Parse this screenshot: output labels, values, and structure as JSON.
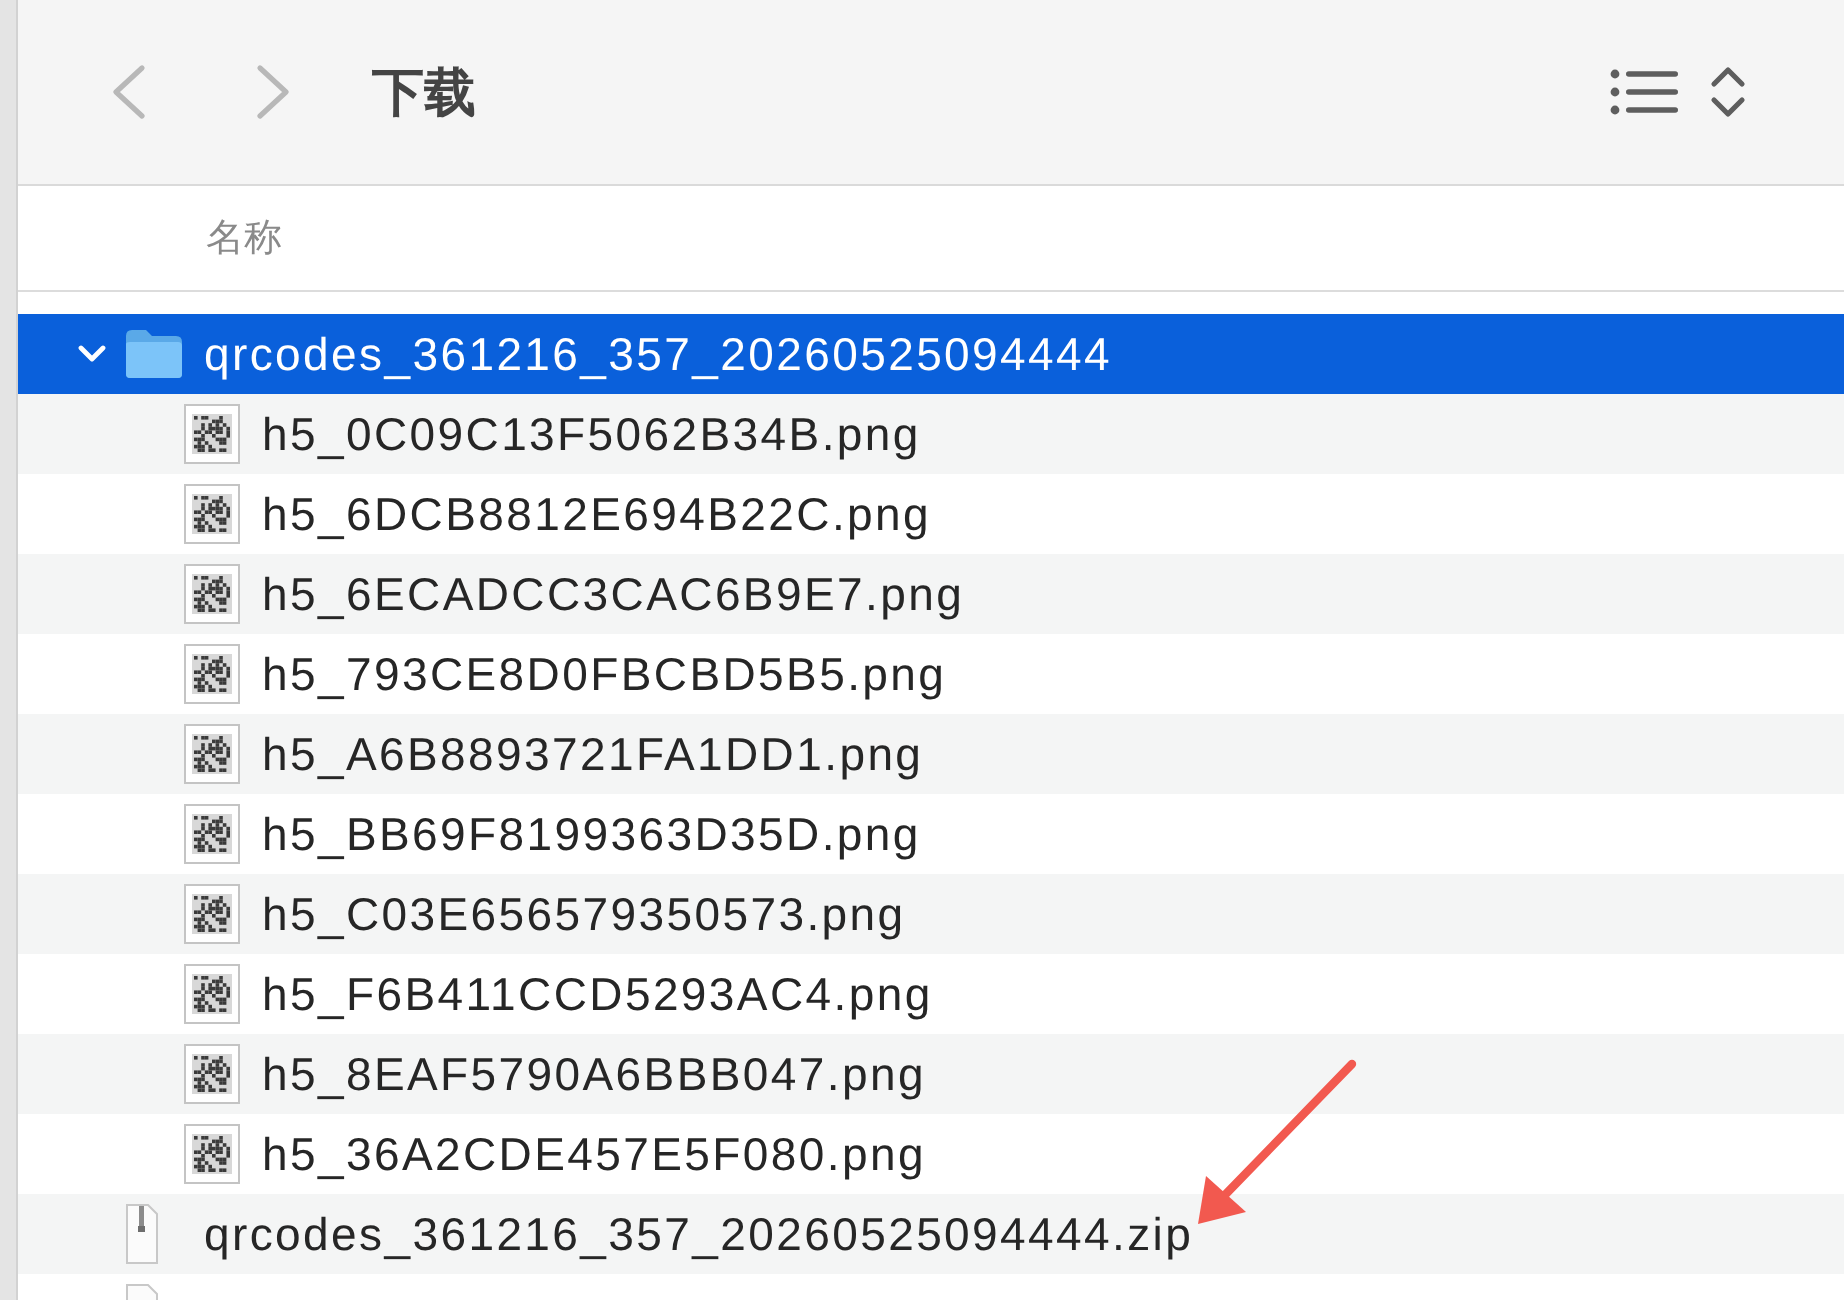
{
  "window": {
    "title": "下载"
  },
  "toolbar": {
    "back_button": {
      "disabled": true
    },
    "forward_button": {
      "disabled": true
    }
  },
  "columns": [
    "名称"
  ],
  "files": [
    {
      "kind": "folder",
      "name": "qrcodes_361216_357_20260525094444",
      "selected": true,
      "expanded": true,
      "children": [
        {
          "kind": "image",
          "name": "h5_0C09C13F5062B34B.png",
          "selected": false
        },
        {
          "kind": "image",
          "name": "h5_6DCB8812E694B22C.png",
          "selected": false
        },
        {
          "kind": "image",
          "name": "h5_6ECADCC3CAC6B9E7.png",
          "selected": false
        },
        {
          "kind": "image",
          "name": "h5_793CE8D0FBCBD5B5.png",
          "selected": false
        },
        {
          "kind": "image",
          "name": "h5_A6B8893721FA1DD1.png",
          "selected": false
        },
        {
          "kind": "image",
          "name": "h5_BB69F8199363D35D.png",
          "selected": false
        },
        {
          "kind": "image",
          "name": "h5_C03E656579350573.png",
          "selected": false
        },
        {
          "kind": "image",
          "name": "h5_F6B411CCD5293AC4.png",
          "selected": false
        },
        {
          "kind": "image",
          "name": "h5_8EAF5790A6BBB047.png",
          "selected": false
        },
        {
          "kind": "image",
          "name": "h5_36A2CDE457E5F080.png",
          "selected": false
        }
      ]
    },
    {
      "kind": "zip",
      "name": "qrcodes_361216_357_20260525094444.zip",
      "selected": false
    },
    {
      "kind": "document",
      "selected": false
    }
  ],
  "annotations": [
    {
      "kind": "arrow"
    }
  ]
}
